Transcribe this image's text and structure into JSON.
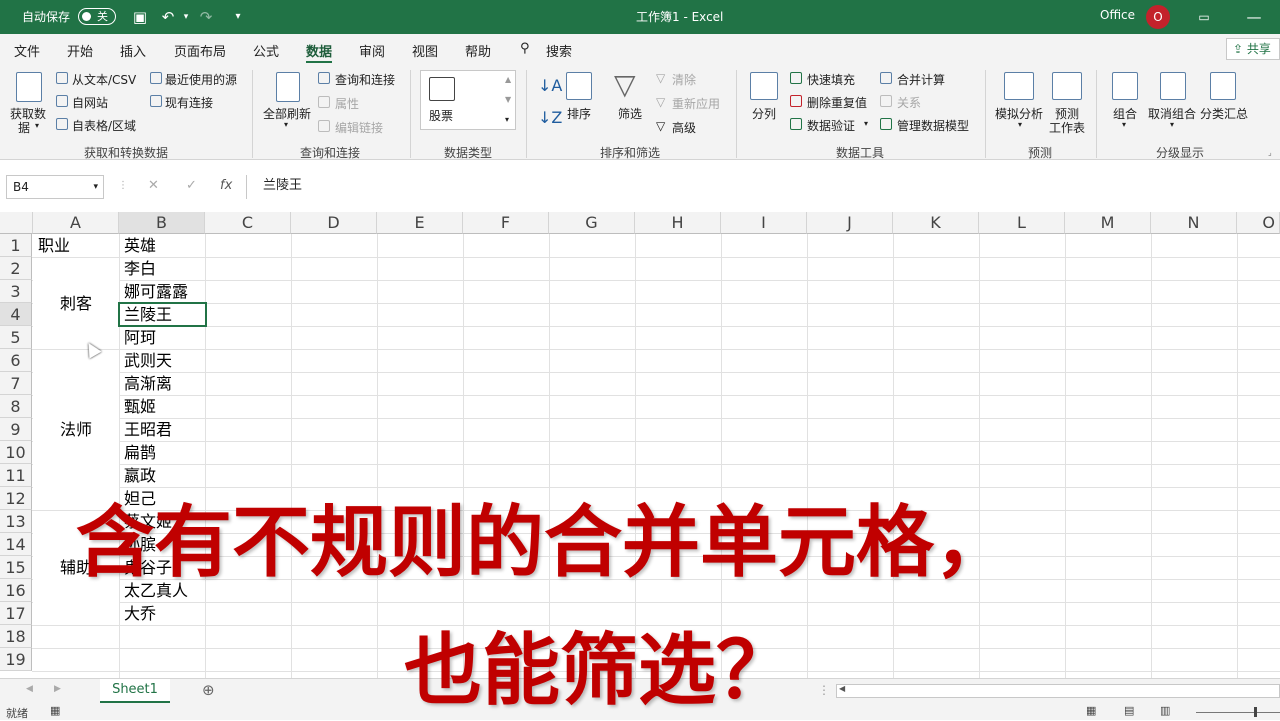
{
  "titlebar": {
    "autosave_label": "自动保存",
    "autosave_state": "关",
    "title": "工作簿1  -  Excel",
    "account": "Office",
    "avatar_initial": "O"
  },
  "menu": [
    "文件",
    "开始",
    "插入",
    "页面布局",
    "公式",
    "数据",
    "审阅",
    "视图",
    "帮助",
    "搜索"
  ],
  "share": "共享",
  "ribbon": {
    "get": {
      "get_data": "获取数",
      "get_data2": "据",
      "from_text": "从文本/CSV",
      "from_web": "自网站",
      "from_table": "自表格/区域",
      "recent": "最近使用的源",
      "existing": "现有连接",
      "label": "获取和转换数据"
    },
    "query": {
      "refresh_all": "全部刷新",
      "queries": "查询和连接",
      "properties": "属性",
      "edit_links": "编辑链接",
      "label": "查询和连接"
    },
    "types": {
      "stock": "股票",
      "label": "数据类型"
    },
    "sort": {
      "sort": "排序",
      "filter": "筛选",
      "clear": "清除",
      "reapply": "重新应用",
      "advanced": "高级",
      "label": "排序和筛选"
    },
    "tools": {
      "split": "分列",
      "flash": "快速填充",
      "remove_dup": "删除重复值",
      "validation": "数据验证",
      "consolidate": "合并计算",
      "relations": "关系",
      "model": "管理数据模型",
      "label": "数据工具"
    },
    "forecast": {
      "whatif": "模拟分析",
      "sheet": "预测",
      "sheet2": "工作表",
      "label": "预测"
    },
    "outline": {
      "group": "组合",
      "ungroup": "取消组合",
      "subtotal": "分类汇总",
      "label": "分级显示"
    }
  },
  "formula_bar": {
    "name_box": "B4",
    "fx": "fx",
    "value": "兰陵王"
  },
  "columns": [
    "A",
    "B",
    "C",
    "D",
    "E",
    "F",
    "G",
    "H",
    "I",
    "J",
    "K",
    "L",
    "M",
    "N",
    "O"
  ],
  "rows": [
    "1",
    "2",
    "3",
    "4",
    "5",
    "6",
    "7",
    "8",
    "9",
    "10",
    "11",
    "12",
    "13",
    "14",
    "15",
    "16",
    "17",
    "18",
    "19"
  ],
  "cells": {
    "A1": "职业",
    "B": [
      "英雄",
      "李白",
      "娜可露露",
      "兰陵王",
      "阿珂",
      "武则天",
      "高渐离",
      "甄姬",
      "王昭君",
      "扁鹊",
      "嬴政",
      "妲己",
      "蔡文姬",
      "孙膑",
      "鬼谷子",
      "太乙真人",
      "大乔"
    ],
    "merged": [
      "刺客",
      "法师",
      "辅助"
    ]
  },
  "sheet_tab": "Sheet1",
  "status": "就绪",
  "overlay": {
    "line1": "含有不规则的合并单元格，",
    "line2": "也能筛选？"
  }
}
